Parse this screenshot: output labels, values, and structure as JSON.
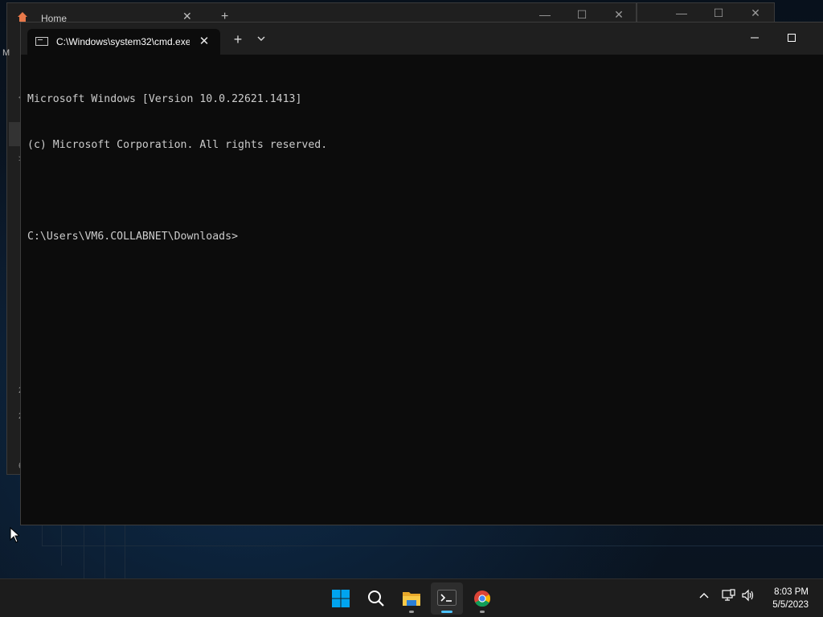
{
  "background_window_1": {
    "tab_label": "Home",
    "add_tab": "+",
    "edge_glyphs": [
      "M",
      "<",
      ">",
      "2",
      "2",
      "6"
    ]
  },
  "terminal": {
    "tab_title": "C:\\Windows\\system32\\cmd.exe",
    "close_tab": "✕",
    "new_tab": "+",
    "dropdown": "⌄",
    "minimize": "—",
    "maximize": "☐",
    "lines": [
      "Microsoft Windows [Version 10.0.22621.1413]",
      "(c) Microsoft Corporation. All rights reserved.",
      "",
      "C:\\Users\\VM6.COLLABNET\\Downloads>"
    ]
  },
  "taskbar": {
    "apps": [
      {
        "name": "start",
        "icon": "windows-logo-icon"
      },
      {
        "name": "search",
        "icon": "search-icon"
      },
      {
        "name": "file-explorer",
        "icon": "folder-icon"
      },
      {
        "name": "terminal",
        "icon": "terminal-icon",
        "active": true
      },
      {
        "name": "chrome",
        "icon": "chrome-icon"
      }
    ],
    "tray": {
      "chevron": "^",
      "time": "8:03 PM",
      "date": "5/5/2023"
    }
  },
  "colors": {
    "accent": "#4cc2ff",
    "terminal_bg": "#0c0c0c",
    "terminal_text": "#cccccc",
    "windows_blue": "#00a4ef"
  }
}
